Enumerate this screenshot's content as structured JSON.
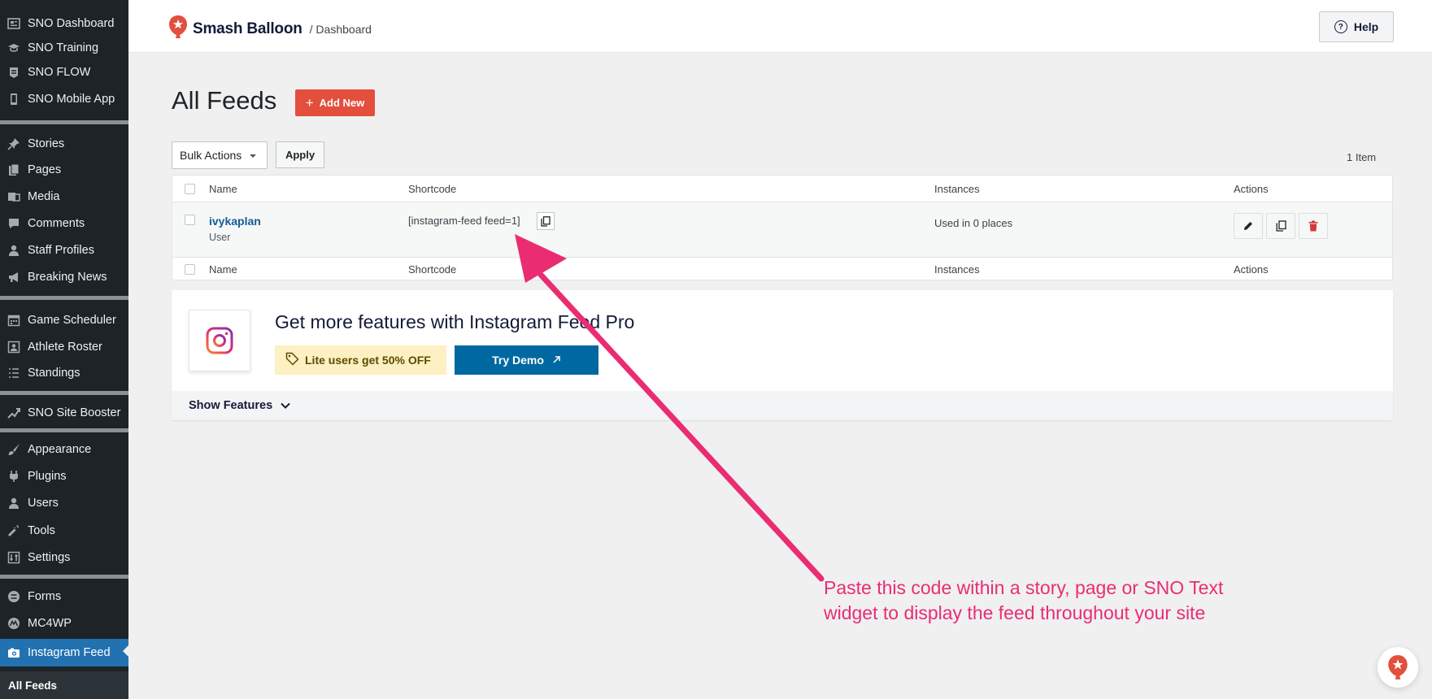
{
  "sidebar": {
    "items": [
      {
        "label": "SNO Dashboard",
        "icon": "dashboard-icon"
      },
      {
        "label": "SNO Training",
        "icon": "graduation-cap-icon"
      },
      {
        "label": "SNO FLOW",
        "icon": "flow-icon"
      },
      {
        "label": "SNO Mobile App",
        "icon": "smartphone-icon"
      },
      {
        "label": "Stories",
        "icon": "pushpin-icon"
      },
      {
        "label": "Pages",
        "icon": "pages-icon"
      },
      {
        "label": "Media",
        "icon": "media-icon"
      },
      {
        "label": "Comments",
        "icon": "comment-icon"
      },
      {
        "label": "Staff Profiles",
        "icon": "person-icon"
      },
      {
        "label": "Breaking News",
        "icon": "megaphone-icon"
      },
      {
        "label": "Game Scheduler",
        "icon": "calendar-icon"
      },
      {
        "label": "Athlete Roster",
        "icon": "roster-icon"
      },
      {
        "label": "Standings",
        "icon": "list-icon"
      },
      {
        "label": "SNO Site Booster",
        "icon": "booster-icon"
      },
      {
        "label": "Appearance",
        "icon": "paintbrush-icon"
      },
      {
        "label": "Plugins",
        "icon": "plugin-icon"
      },
      {
        "label": "Users",
        "icon": "users-icon"
      },
      {
        "label": "Tools",
        "icon": "wrench-icon"
      },
      {
        "label": "Settings",
        "icon": "settings-icon"
      },
      {
        "label": "Forms",
        "icon": "forms-icon"
      },
      {
        "label": "MC4WP",
        "icon": "mc4wp-icon"
      },
      {
        "label": "Instagram Feed",
        "icon": "camera-icon"
      }
    ],
    "submenu": {
      "label": "All Feeds"
    }
  },
  "header": {
    "brand": "Smash Balloon",
    "breadcrumb": "/ Dashboard",
    "help_label": "Help"
  },
  "page": {
    "title": "All Feeds",
    "add_new_label": "Add New",
    "plus_glyph": "+"
  },
  "bulk": {
    "selected": "Bulk Actions",
    "apply_label": "Apply",
    "item_count": "1 Item"
  },
  "table": {
    "columns": [
      "Name",
      "Shortcode",
      "Instances",
      "Actions"
    ],
    "rows": [
      {
        "name": "ivykaplan",
        "type": "User",
        "shortcode": "[instagram-feed feed=1]",
        "instances": "Used in 0 places"
      }
    ]
  },
  "pro": {
    "title": "Get more features with Instagram Feed Pro",
    "discount": "Lite users get 50% OFF",
    "try_demo": "Try Demo",
    "show_features": "Show Features"
  },
  "annotation": {
    "text": "Paste this code within a story, page or SNO Text widget to display the feed throughout your site",
    "color": "#ea2d72"
  },
  "colors": {
    "sidebar_bg": "#1d2327",
    "active": "#2271b1",
    "add_new": "#e34f3d",
    "try_demo": "#0068a0",
    "discount_bg": "#fdf0c2",
    "delete": "#d63638"
  }
}
